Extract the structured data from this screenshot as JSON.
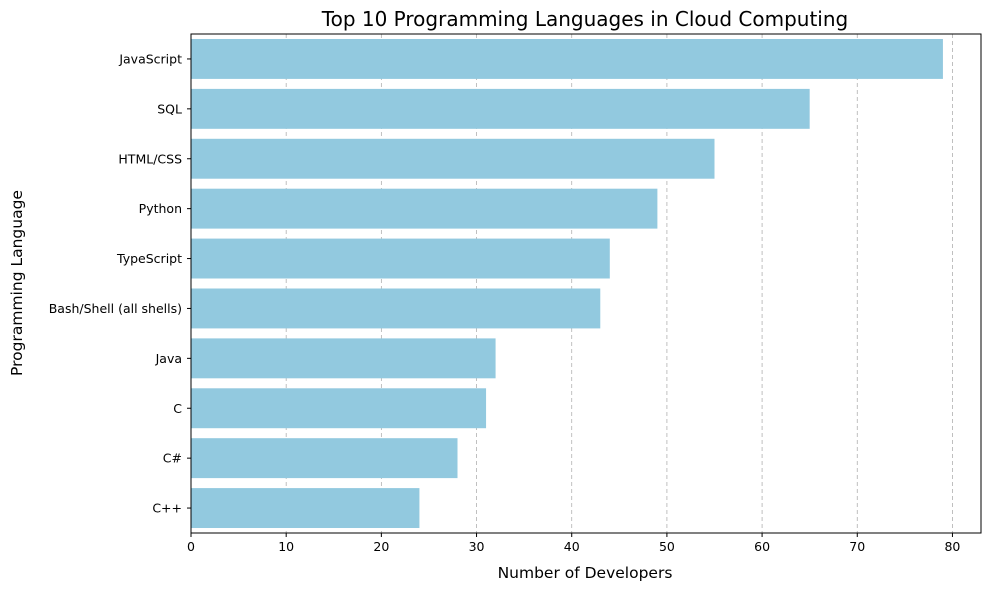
{
  "chart_data": {
    "type": "bar",
    "orientation": "horizontal",
    "title": "Top 10 Programming Languages in Cloud Computing",
    "xlabel": "Number of Developers",
    "ylabel": "Programming Language",
    "categories": [
      "JavaScript",
      "SQL",
      "HTML/CSS",
      "Python",
      "TypeScript",
      "Bash/Shell (all shells)",
      "Java",
      "C",
      "C#",
      "C++"
    ],
    "values": [
      79,
      65,
      55,
      49,
      44,
      43,
      32,
      31,
      28,
      24
    ],
    "xlim": [
      0,
      83
    ],
    "xticks": [
      0,
      10,
      20,
      30,
      40,
      50,
      60,
      70,
      80
    ],
    "grid": "x-axis dashed",
    "bar_color": "#92c9df",
    "grid_color": "#b0b0b0"
  }
}
